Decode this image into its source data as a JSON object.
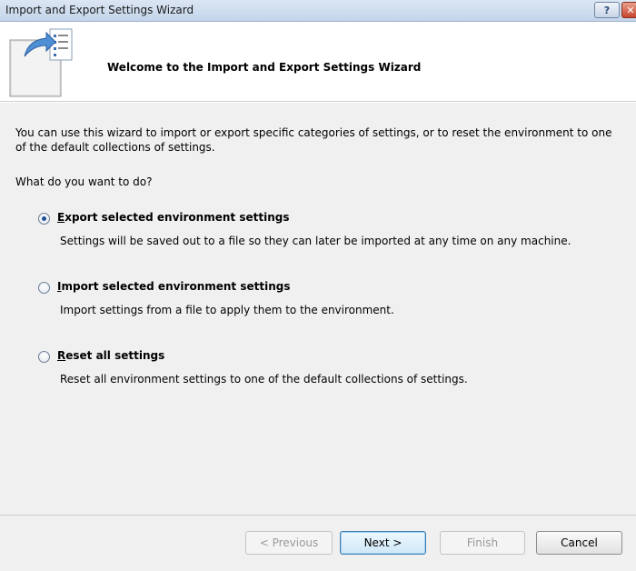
{
  "window": {
    "title": "Import and Export Settings Wizard",
    "help_glyph": "?",
    "close_glyph": "✕"
  },
  "header": {
    "title": "Welcome to the Import and Export Settings Wizard",
    "icon": "import-export-settings-icon"
  },
  "content": {
    "intro": "You can use this wizard to import or export specific categories of settings, or to reset the environment to one of the default collections of settings.",
    "question": "What do you want to do?",
    "options": [
      {
        "label": "Export selected environment settings",
        "mnemonic": "E",
        "description": "Settings will be saved out to a file so they can later be imported at any time on any machine.",
        "selected": true
      },
      {
        "label": "Import selected environment settings",
        "mnemonic": "I",
        "description": "Import settings from a file to apply them to the environment.",
        "selected": false
      },
      {
        "label": "Reset all settings",
        "mnemonic": "R",
        "description": "Reset all environment settings to one of the default collections of settings.",
        "selected": false
      }
    ]
  },
  "footer": {
    "previous_label": "< Previous",
    "next_label": "Next >",
    "finish_label": "Finish",
    "cancel_label": "Cancel"
  },
  "colors": {
    "titlebar": "#c4d5ea",
    "content_bg": "#f0f0f0",
    "radio_dot": "#1f4f96",
    "close_button": "#c7452c"
  }
}
